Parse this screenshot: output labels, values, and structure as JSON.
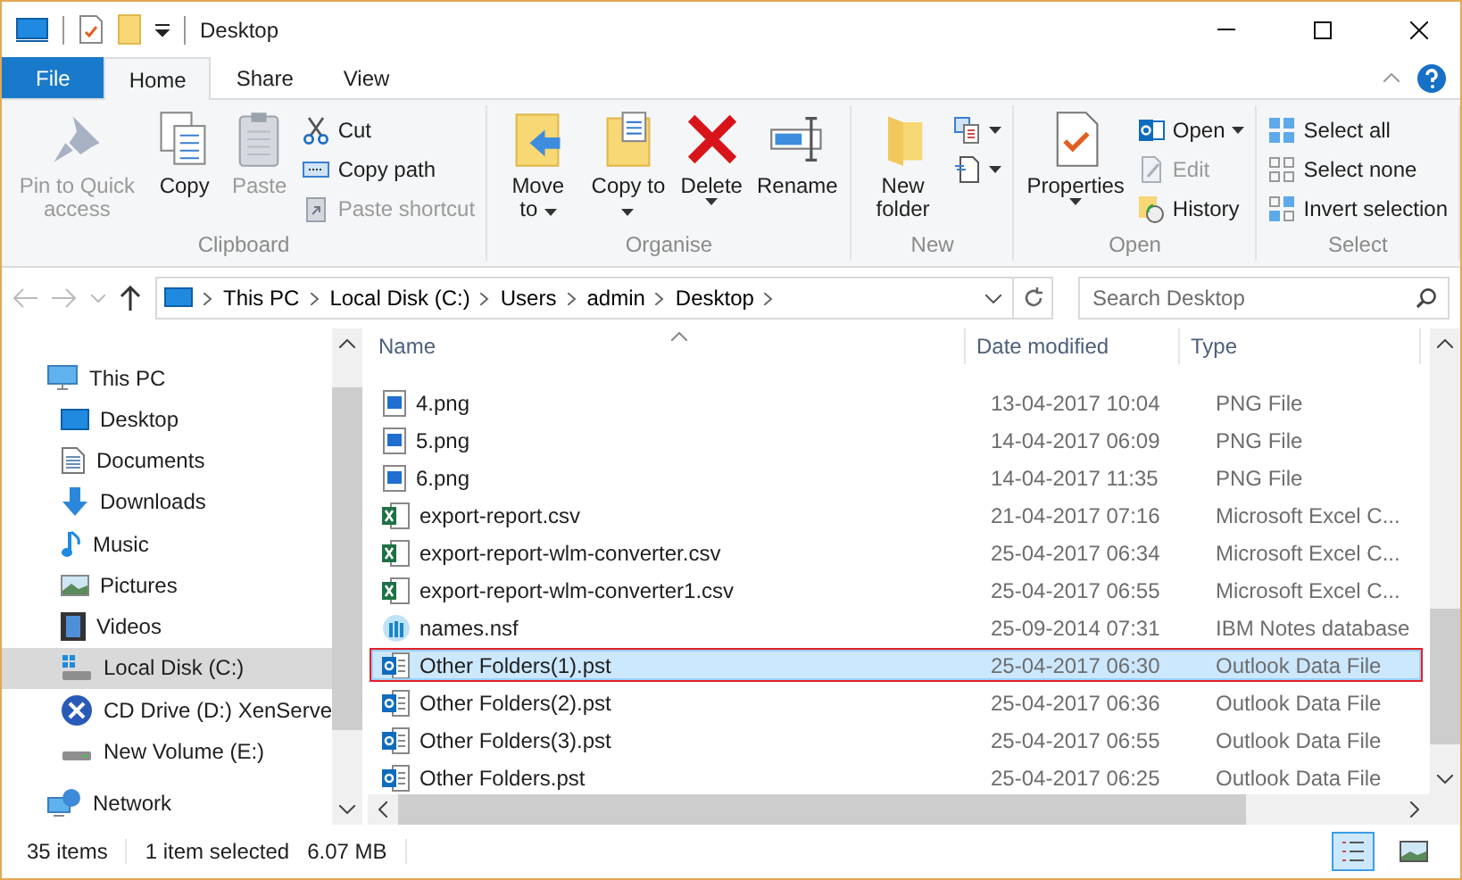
{
  "window": {
    "title": "Desktop"
  },
  "tabs": [
    {
      "label": "File",
      "kind": "file",
      "selected": false
    },
    {
      "label": "Home",
      "kind": "tab",
      "selected": true
    },
    {
      "label": "Share",
      "kind": "tab",
      "selected": false
    },
    {
      "label": "View",
      "kind": "tab",
      "selected": false
    }
  ],
  "ribbon": {
    "groups": [
      {
        "label": "Clipboard",
        "items": [
          {
            "kind": "large",
            "label": "Pin to Quick access",
            "disabled": true
          },
          {
            "kind": "large",
            "label": "Copy",
            "disabled": false
          },
          {
            "kind": "large",
            "label": "Paste",
            "disabled": true
          },
          {
            "kind": "stack",
            "items": [
              {
                "label": "Cut",
                "disabled": false
              },
              {
                "label": "Copy path",
                "disabled": false
              },
              {
                "label": "Paste shortcut",
                "disabled": true
              }
            ]
          }
        ]
      },
      {
        "label": "Organise",
        "items": [
          {
            "kind": "large",
            "label": "Move to",
            "disabled": false
          },
          {
            "kind": "large",
            "label": "Copy to",
            "disabled": false
          },
          {
            "kind": "large",
            "label": "Delete",
            "disabled": false
          },
          {
            "kind": "large",
            "label": "Rename",
            "disabled": false
          }
        ]
      },
      {
        "label": "New",
        "items": [
          {
            "kind": "large",
            "label": "New folder",
            "disabled": false
          },
          {
            "kind": "icon_stack"
          }
        ]
      },
      {
        "label": "Open",
        "items": [
          {
            "kind": "large",
            "label": "Properties",
            "disabled": false
          },
          {
            "kind": "stack",
            "items": [
              {
                "label": "Open",
                "disabled": false
              },
              {
                "label": "Edit",
                "disabled": true
              },
              {
                "label": "History",
                "disabled": false
              }
            ]
          }
        ]
      },
      {
        "label": "Select",
        "items": [
          {
            "kind": "stack",
            "items": [
              {
                "label": "Select all",
                "disabled": false
              },
              {
                "label": "Select none",
                "disabled": false
              },
              {
                "label": "Invert selection",
                "disabled": false
              }
            ]
          }
        ]
      }
    ]
  },
  "address": {
    "segments": [
      "This PC",
      "Local Disk (C:)",
      "Users",
      "admin",
      "Desktop"
    ]
  },
  "search": {
    "placeholder": "Search Desktop"
  },
  "sidebar": {
    "items": [
      {
        "label": "This PC",
        "kind": "pc",
        "selected": false,
        "children": [
          {
            "label": "Desktop",
            "kind": "desktop",
            "selected": false
          },
          {
            "label": "Documents",
            "kind": "documents",
            "selected": false
          },
          {
            "label": "Downloads",
            "kind": "downloads",
            "selected": false
          },
          {
            "label": "Music",
            "kind": "music",
            "selected": false
          },
          {
            "label": "Pictures",
            "kind": "pictures",
            "selected": false
          },
          {
            "label": "Videos",
            "kind": "videos",
            "selected": false
          },
          {
            "label": "Local Disk (C:)",
            "kind": "disk",
            "selected": true
          },
          {
            "label": "CD Drive (D:) XenServe",
            "kind": "cd",
            "selected": false
          },
          {
            "label": "New Volume (E:)",
            "kind": "drive",
            "selected": false
          }
        ]
      },
      {
        "label": "Network",
        "kind": "network",
        "selected": false
      }
    ]
  },
  "table": {
    "columns": [
      "Name",
      "Date modified",
      "Type"
    ],
    "rows": [
      {
        "name": "4.png",
        "date": "13-04-2017 10:04",
        "type": "PNG File",
        "kind": "image",
        "selected": false
      },
      {
        "name": "5.png",
        "date": "14-04-2017 06:09",
        "type": "PNG File",
        "kind": "image",
        "selected": false
      },
      {
        "name": "6.png",
        "date": "14-04-2017 11:35",
        "type": "PNG File",
        "kind": "image",
        "selected": false
      },
      {
        "name": "export-report.csv",
        "date": "21-04-2017 07:16",
        "type": "Microsoft Excel C...",
        "kind": "excel",
        "selected": false
      },
      {
        "name": "export-report-wlm-converter.csv",
        "date": "25-04-2017 06:34",
        "type": "Microsoft Excel C...",
        "kind": "excel",
        "selected": false
      },
      {
        "name": "export-report-wlm-converter1.csv",
        "date": "25-04-2017 06:55",
        "type": "Microsoft Excel C...",
        "kind": "excel",
        "selected": false
      },
      {
        "name": "names.nsf",
        "date": "25-09-2014 07:31",
        "type": "IBM Notes database",
        "kind": "notes",
        "selected": false
      },
      {
        "name": "Other Folders(1).pst",
        "date": "25-04-2017 06:30",
        "type": "Outlook Data File",
        "kind": "outlook",
        "selected": true
      },
      {
        "name": "Other Folders(2).pst",
        "date": "25-04-2017 06:36",
        "type": "Outlook Data File",
        "kind": "outlook",
        "selected": false
      },
      {
        "name": "Other Folders(3).pst",
        "date": "25-04-2017 06:55",
        "type": "Outlook Data File",
        "kind": "outlook",
        "selected": false
      },
      {
        "name": "Other Folders.pst",
        "date": "25-04-2017 06:25",
        "type": "Outlook Data File",
        "kind": "outlook",
        "selected": false
      }
    ]
  },
  "status_bar": {
    "count": "35 items",
    "selection": "1 item selected",
    "size": "6.07 MB",
    "views": [
      {
        "kind": "details",
        "selected": true
      },
      {
        "kind": "large",
        "selected": false
      }
    ]
  }
}
